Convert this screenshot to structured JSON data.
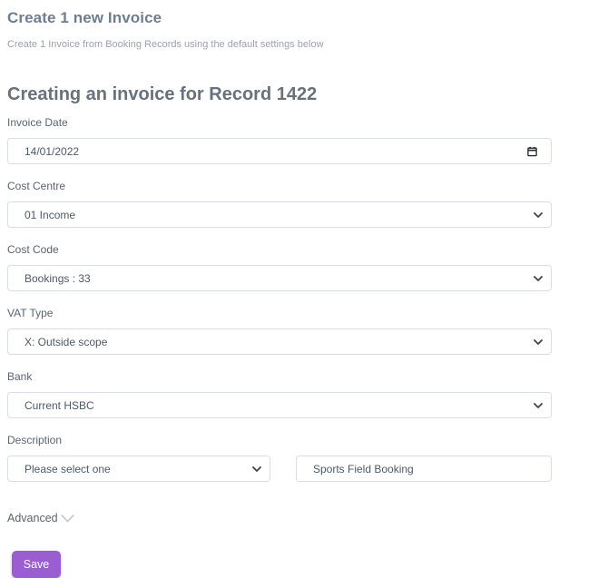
{
  "page": {
    "title": "Create 1 new Invoice",
    "subtitle": "Create 1 Invoice from Booking Records using the default settings below",
    "section_heading": "Creating an invoice for Record 1422"
  },
  "form": {
    "invoice_date": {
      "label": "Invoice Date",
      "value": "14/01/2022"
    },
    "cost_centre": {
      "label": "Cost Centre",
      "value": "01 Income"
    },
    "cost_code": {
      "label": "Cost Code",
      "value": "Bookings : 33"
    },
    "vat_type": {
      "label": "VAT Type",
      "value": "X: Outside scope"
    },
    "bank": {
      "label": "Bank",
      "value": "Current HSBC"
    },
    "description": {
      "label": "Description",
      "select_value": "Please select one",
      "text_value": "Sports Field Booking"
    },
    "advanced_label": "Advanced",
    "save_label": "Save"
  },
  "icons": {
    "calendar": "calendar-icon",
    "select_chevron": "chevron-down-icon",
    "advanced_chevron": "chevron-down-icon"
  },
  "colors": {
    "accent_purple": "#9b5ed2",
    "field_border": "#d9dde9",
    "heading_text": "#68717e",
    "title_text": "#6e7e90",
    "body_text": "#5a6472",
    "muted_text": "#9aa2ac"
  }
}
